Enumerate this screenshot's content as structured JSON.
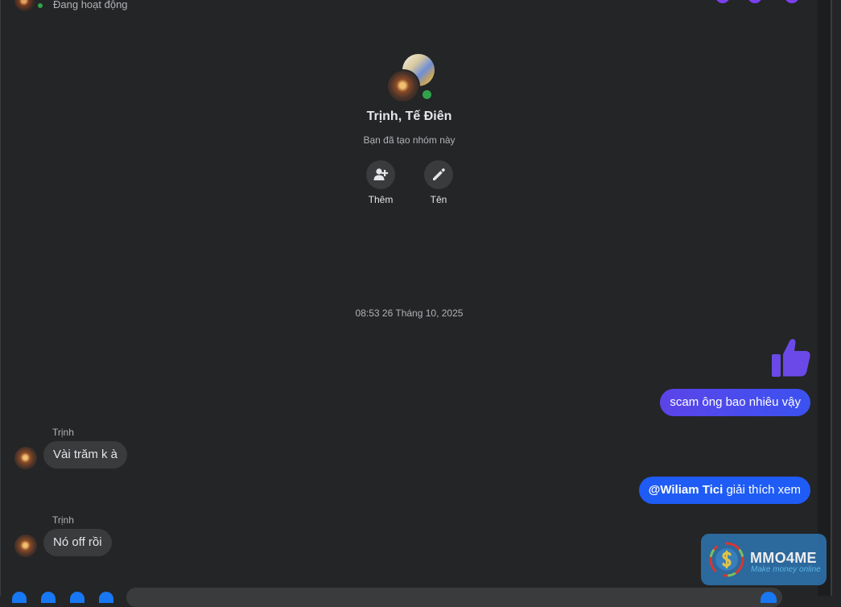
{
  "header": {
    "status": "Đang hoạt động",
    "icons": [
      "phone-icon",
      "video-icon",
      "info-icon"
    ],
    "accent": "#7b3ff2"
  },
  "group": {
    "name": "Trịnh, Tế Điên",
    "subtitle": "Bạn đã tạo nhóm này",
    "actions": [
      {
        "label": "Thêm",
        "icon": "add-person-icon"
      },
      {
        "label": "Tên",
        "icon": "pencil-icon"
      }
    ]
  },
  "timestamp": "08:53 26 Tháng 10, 2025",
  "messages": {
    "like_icon": "thumbs-up-icon",
    "out1": "scam ông bao nhiêu vậy",
    "in1_sender": "Trịnh",
    "in1": "Vài trăm k à",
    "out2_mention": "@Wiliam Tici",
    "out2_text": " giải thích xem",
    "in2_sender": "Trịnh",
    "in2": "Nó off rồi"
  },
  "watermark": {
    "brand": "MMO4ME",
    "tagline": "Make money online"
  },
  "colors": {
    "background": "#242526",
    "bubble_in": "#3a3b3c",
    "bubble_out": "#1f5cf5",
    "online": "#31a24c",
    "like": "#6b49e8"
  }
}
